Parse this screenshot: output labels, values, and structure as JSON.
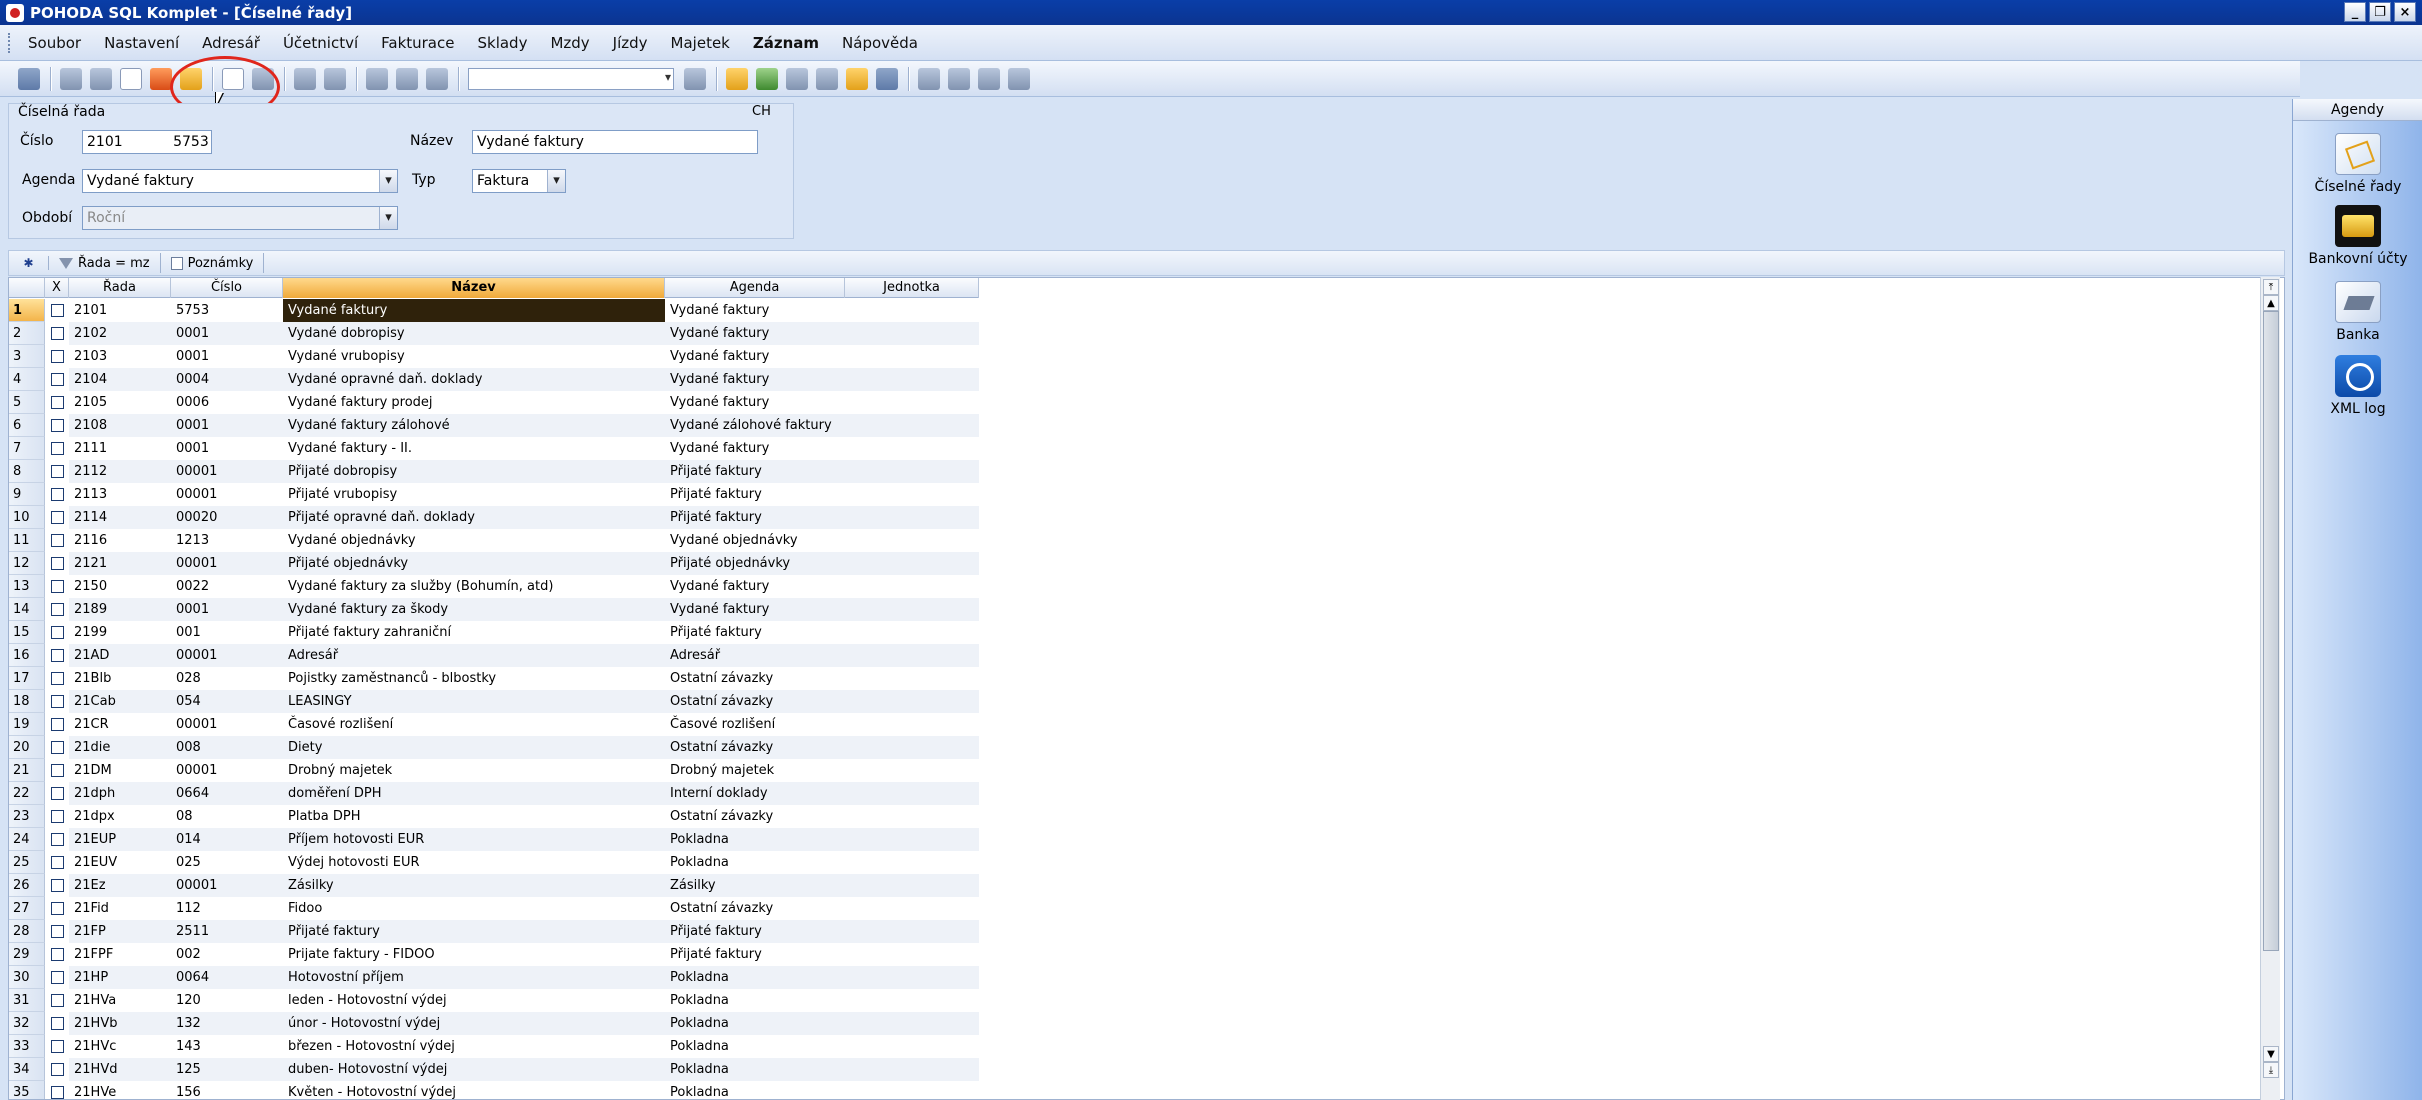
{
  "window": {
    "title": "POHODA SQL Komplet - [Číselné řady]"
  },
  "menu": [
    "Soubor",
    "Nastavení",
    "Adresář",
    "Účetnictví",
    "Fakturace",
    "Sklady",
    "Mzdy",
    "Jízdy",
    "Majetek",
    "Záznam",
    "Nápověda"
  ],
  "form": {
    "group_title": "Číselná řada",
    "ch": "CH",
    "cislo_label": "Číslo",
    "cislo_rada": "2101",
    "cislo_value": "5753",
    "nazev_label": "Název",
    "nazev_value": "Vydané faktury",
    "agenda_label": "Agenda",
    "agenda_value": "Vydané faktury",
    "typ_label": "Typ",
    "typ_value": "Faktura",
    "obdobi_label": "Období",
    "obdobi_value": "Roční"
  },
  "tabs": {
    "filter": "Řada = mz",
    "notes": "Poznámky"
  },
  "grid": {
    "columns": [
      "X",
      "Řada",
      "Číslo",
      "Název",
      "Agenda",
      "Jednotka"
    ],
    "rows": [
      {
        "n": "1",
        "rada": "2101",
        "cislo": "5753",
        "nazev": "Vydané faktury",
        "agenda": "Vydané faktury"
      },
      {
        "n": "2",
        "rada": "2102",
        "cislo": "0001",
        "nazev": "Vydané dobropisy",
        "agenda": "Vydané faktury"
      },
      {
        "n": "3",
        "rada": "2103",
        "cislo": "0001",
        "nazev": "Vydané vrubopisy",
        "agenda": "Vydané faktury"
      },
      {
        "n": "4",
        "rada": "2104",
        "cislo": "0004",
        "nazev": "Vydané opravné daň. doklady",
        "agenda": "Vydané faktury"
      },
      {
        "n": "5",
        "rada": "2105",
        "cislo": "0006",
        "nazev": "Vydané faktury prodej",
        "agenda": "Vydané faktury"
      },
      {
        "n": "6",
        "rada": "2108",
        "cislo": "0001",
        "nazev": "Vydané faktury zálohové",
        "agenda": "Vydané zálohové faktury"
      },
      {
        "n": "7",
        "rada": "2111",
        "cislo": "0001",
        "nazev": "Vydané faktury - II.",
        "agenda": "Vydané faktury"
      },
      {
        "n": "8",
        "rada": "2112",
        "cislo": "00001",
        "nazev": "Přijaté dobropisy",
        "agenda": "Přijaté faktury"
      },
      {
        "n": "9",
        "rada": "2113",
        "cislo": "00001",
        "nazev": "Přijaté vrubopisy",
        "agenda": "Přijaté faktury"
      },
      {
        "n": "10",
        "rada": "2114",
        "cislo": "00020",
        "nazev": "Přijaté opravné daň. doklady",
        "agenda": "Přijaté faktury"
      },
      {
        "n": "11",
        "rada": "2116",
        "cislo": "1213",
        "nazev": "Vydané objednávky",
        "agenda": "Vydané objednávky"
      },
      {
        "n": "12",
        "rada": "2121",
        "cislo": "00001",
        "nazev": "Přijaté objednávky",
        "agenda": "Přijaté objednávky"
      },
      {
        "n": "13",
        "rada": "2150",
        "cislo": "0022",
        "nazev": "Vydané faktury za služby (Bohumín, atd)",
        "agenda": "Vydané faktury"
      },
      {
        "n": "14",
        "rada": "2189",
        "cislo": "0001",
        "nazev": "Vydané faktury za škody",
        "agenda": "Vydané faktury"
      },
      {
        "n": "15",
        "rada": "2199",
        "cislo": "001",
        "nazev": "Přijaté faktury zahraniční",
        "agenda": "Přijaté faktury"
      },
      {
        "n": "16",
        "rada": "21AD",
        "cislo": "00001",
        "nazev": "Adresář",
        "agenda": "Adresář"
      },
      {
        "n": "17",
        "rada": "21Blb",
        "cislo": "028",
        "nazev": "Pojistky zaměstnanců - blbostky",
        "agenda": "Ostatní závazky"
      },
      {
        "n": "18",
        "rada": "21Cab",
        "cislo": "054",
        "nazev": "LEASINGY",
        "agenda": "Ostatní závazky"
      },
      {
        "n": "19",
        "rada": "21CR",
        "cislo": "00001",
        "nazev": "Časové rozlišení",
        "agenda": "Časové rozlišení"
      },
      {
        "n": "20",
        "rada": "21die",
        "cislo": "008",
        "nazev": "Diety",
        "agenda": "Ostatní závazky"
      },
      {
        "n": "21",
        "rada": "21DM",
        "cislo": "00001",
        "nazev": "Drobný majetek",
        "agenda": "Drobný majetek"
      },
      {
        "n": "22",
        "rada": "21dph",
        "cislo": "0664",
        "nazev": "doměření DPH",
        "agenda": "Interní doklady"
      },
      {
        "n": "23",
        "rada": "21dpx",
        "cislo": "08",
        "nazev": "Platba DPH",
        "agenda": "Ostatní závazky"
      },
      {
        "n": "24",
        "rada": "21EUP",
        "cislo": "014",
        "nazev": "Příjem hotovosti EUR",
        "agenda": "Pokladna"
      },
      {
        "n": "25",
        "rada": "21EUV",
        "cislo": "025",
        "nazev": "Výdej hotovosti EUR",
        "agenda": "Pokladna"
      },
      {
        "n": "26",
        "rada": "21Ez",
        "cislo": "00001",
        "nazev": "Zásilky",
        "agenda": "Zásilky"
      },
      {
        "n": "27",
        "rada": "21Fid",
        "cislo": "112",
        "nazev": "Fidoo",
        "agenda": "Ostatní závazky"
      },
      {
        "n": "28",
        "rada": "21FP",
        "cislo": "2511",
        "nazev": "Přijaté faktury",
        "agenda": "Přijaté faktury"
      },
      {
        "n": "29",
        "rada": "21FPF",
        "cislo": "002",
        "nazev": "Prijate faktury - FIDOO",
        "agenda": "Přijaté faktury"
      },
      {
        "n": "30",
        "rada": "21HP",
        "cislo": "0064",
        "nazev": "Hotovostní příjem",
        "agenda": "Pokladna"
      },
      {
        "n": "31",
        "rada": "21HVa",
        "cislo": "120",
        "nazev": "leden -  Hotovostní výdej",
        "agenda": "Pokladna"
      },
      {
        "n": "32",
        "rada": "21HVb",
        "cislo": "132",
        "nazev": "únor - Hotovostní výdej",
        "agenda": "Pokladna"
      },
      {
        "n": "33",
        "rada": "21HVc",
        "cislo": "143",
        "nazev": "březen - Hotovostní výdej",
        "agenda": "Pokladna"
      },
      {
        "n": "34",
        "rada": "21HVd",
        "cislo": "125",
        "nazev": "duben- Hotovostní výdej",
        "agenda": "Pokladna"
      },
      {
        "n": "35",
        "rada": "21HVe",
        "cislo": "156",
        "nazev": "Květen - Hotovostní výdej",
        "agenda": "Pokladna"
      }
    ]
  },
  "agendy": {
    "title": "Agendy",
    "items": [
      "Číselné řady",
      "Bankovní účty",
      "Banka",
      "XML log"
    ]
  }
}
